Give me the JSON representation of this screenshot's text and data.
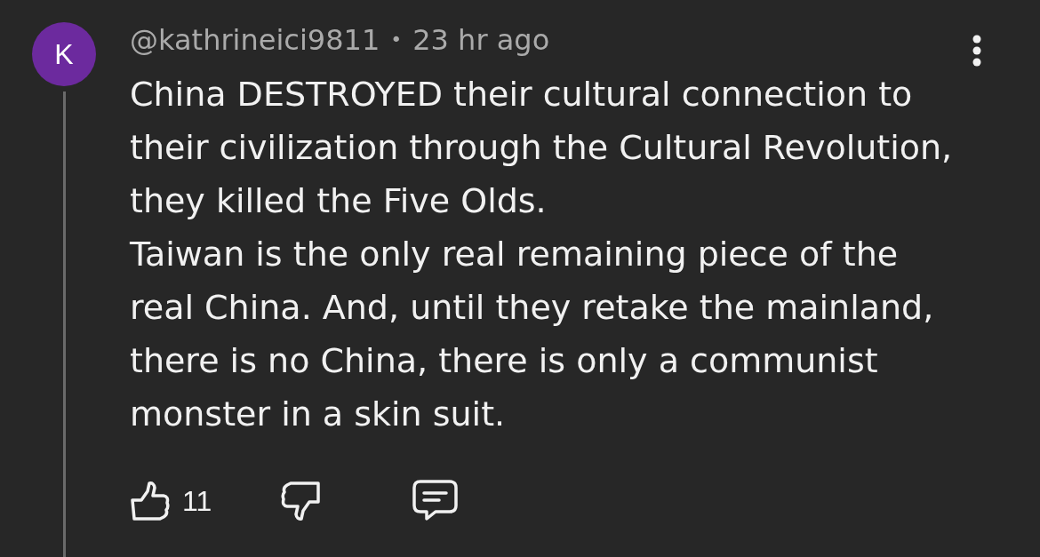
{
  "comment": {
    "avatar": {
      "letter": "K"
    },
    "author": "@kathrineici9811",
    "separator": "•",
    "time": "23 hr ago",
    "text": "China DESTROYED their cultural connection to their civilization through the Cultural Revolution, they killed the Five Olds.\nTaiwan is the only real remaining piece of the real China. And, until they retake the mainland, there is no China, there is only a communist monster in a skin suit.",
    "likes": "11"
  }
}
